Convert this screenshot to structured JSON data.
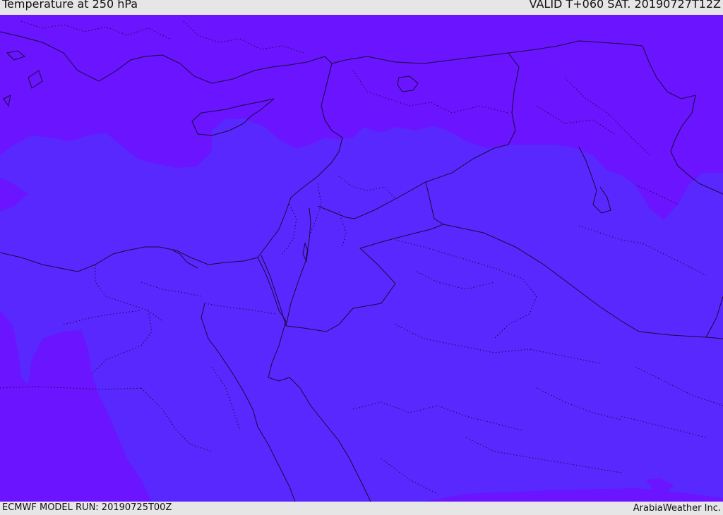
{
  "header": {
    "title": "Temperature at 250 hPa",
    "valid": "VALID T+060 SAT. 20190727T12Z"
  },
  "footer": {
    "model_run": "ECMWF MODEL RUN: 20190725T00Z",
    "credit": "ArabiaWeather Inc."
  },
  "map": {
    "colors": {
      "cold_band": "#6a14ff",
      "warm_band": "#5828ff",
      "border_line": "#1a0a3a"
    }
  }
}
